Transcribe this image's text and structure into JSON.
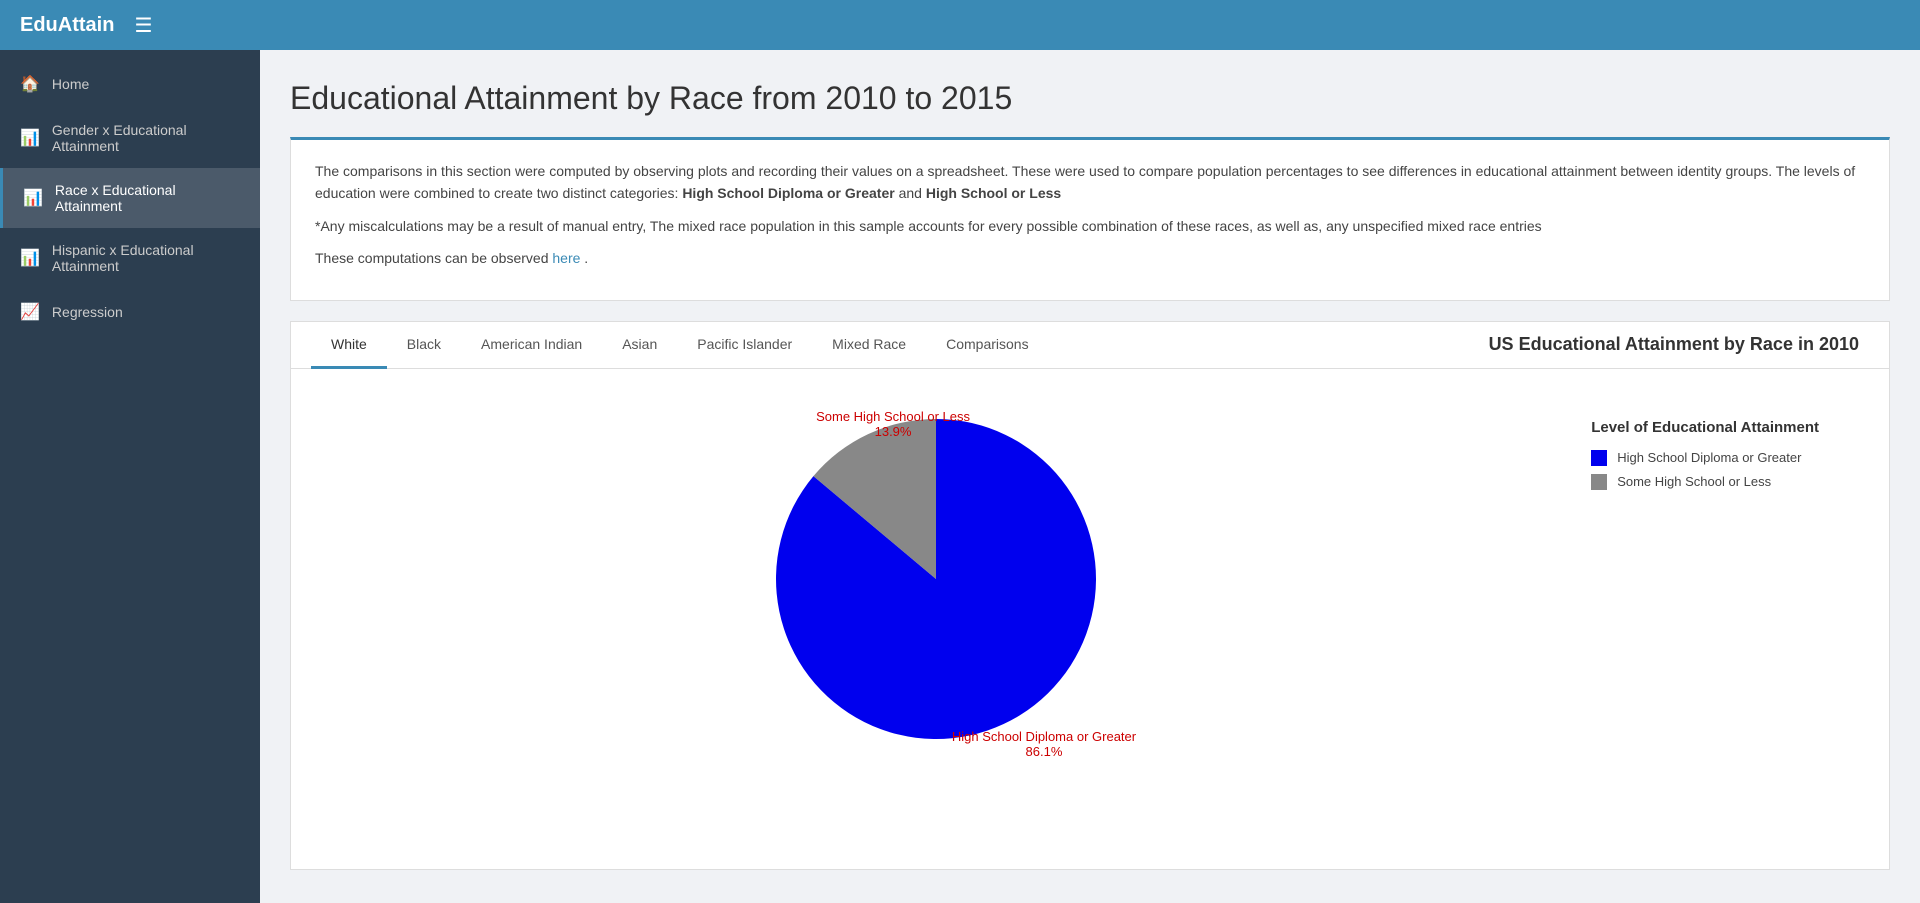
{
  "app": {
    "title": "EduAttain",
    "hamburger": "☰"
  },
  "sidebar": {
    "items": [
      {
        "id": "home",
        "icon": "🏠",
        "label": "Home",
        "active": false
      },
      {
        "id": "gender",
        "icon": "📊",
        "label": "Gender x Educational Attainment",
        "active": false
      },
      {
        "id": "race",
        "icon": "📊",
        "label": "Race x Educational Attainment",
        "active": true
      },
      {
        "id": "hispanic",
        "icon": "📊",
        "label": "Hispanic x Educational Attainment",
        "active": false
      },
      {
        "id": "regression",
        "icon": "📈",
        "label": "Regression",
        "active": false
      }
    ]
  },
  "page": {
    "title": "Educational Attainment by Race from 2010 to 2015",
    "info_text1": "The comparisons in this section were computed by observing plots and recording their values on a spreadsheet. These were used to compare population percentages to see differences in educational attainment between identity groups. The levels of education were combined to create two distinct categories:",
    "bold1": "High School Diploma or Greater",
    "and": " and ",
    "bold2": "High School or Less",
    "info_text2": "*Any miscalculations may be a result of manual entry, The mixed race population in this sample accounts for every possible combination of these races, as well as, any unspecified mixed race entries",
    "computed_text": "These computations can be observed ",
    "here_link": "here",
    "period": "."
  },
  "tabs": {
    "items": [
      {
        "id": "white",
        "label": "White",
        "active": true
      },
      {
        "id": "black",
        "label": "Black",
        "active": false
      },
      {
        "id": "american-indian",
        "label": "American Indian",
        "active": false
      },
      {
        "id": "asian",
        "label": "Asian",
        "active": false
      },
      {
        "id": "pacific-islander",
        "label": "Pacific Islander",
        "active": false
      },
      {
        "id": "mixed-race",
        "label": "Mixed Race",
        "active": false
      },
      {
        "id": "comparisons",
        "label": "Comparisons",
        "active": false
      }
    ],
    "chart_title": "US Educational Attainment by Race in 2010"
  },
  "chart": {
    "blue_label": "High School Diploma or Greater",
    "blue_pct": "86.1%",
    "gray_label": "Some High School or Less",
    "gray_pct": "13.9%",
    "blue_color": "#0000ee",
    "gray_color": "#888888",
    "blue_value": 86.1,
    "gray_value": 13.9
  },
  "legend": {
    "title": "Level of Educational Attainment",
    "items": [
      {
        "label": "High School Diploma or Greater",
        "color": "#0000ee"
      },
      {
        "label": "Some High School or Less",
        "color": "#888888"
      }
    ]
  }
}
